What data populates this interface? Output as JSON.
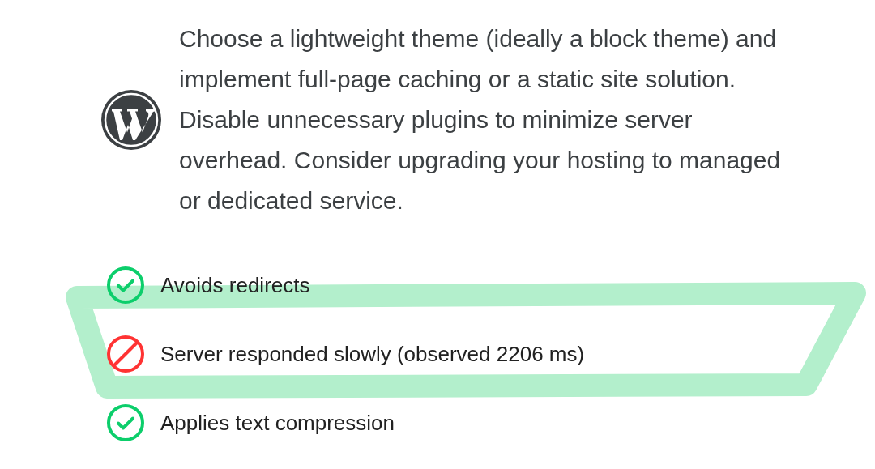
{
  "recommendation": {
    "text": "Choose a lightweight theme (ideally a block theme) and implement full-page caching or a static site solution. Disable unnecessary plugins to minimize server overhead. Consider upgrading your hosting to managed or dedicated service."
  },
  "audits": [
    {
      "kind": "pass",
      "label": "Avoids redirects"
    },
    {
      "kind": "fail",
      "label": "Server responded slowly (observed 2206 ms)"
    },
    {
      "kind": "pass",
      "label": "Applies text compression"
    }
  ]
}
